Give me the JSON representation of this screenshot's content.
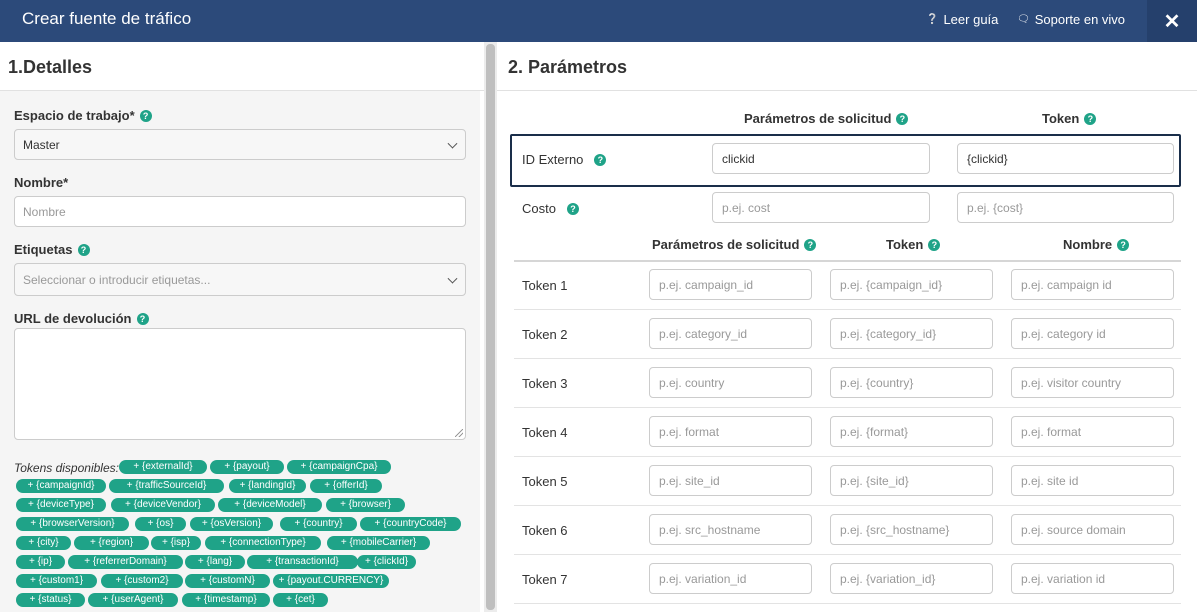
{
  "header": {
    "title": "Crear fuente de tráfico",
    "guide_label": "Leer guía",
    "support_label": "Soporte en vivo",
    "close_label": "✕"
  },
  "details": {
    "title": "1.Detalles",
    "workspace": {
      "label": "Espacio de trabajo*",
      "value": "Master"
    },
    "name": {
      "label": "Nombre*",
      "placeholder": "Nombre"
    },
    "tags": {
      "label": "Etiquetas",
      "placeholder": "Seleccionar o introducir etiquetas..."
    },
    "postback": {
      "label": "URL de devolución",
      "value": ""
    },
    "tokens_label": "Tokens disponibles:",
    "tokens": [
      "+ {externalId}",
      "+ {payout}",
      "+ {campaignCpa}",
      "+ {campaignId}",
      "+ {trafficSourceId}",
      "+ {landingId}",
      "+ {offerId}",
      "+ {deviceType}",
      "+ {deviceVendor}",
      "+ {deviceModel}",
      "+ {browser}",
      "+ {browserVersion}",
      "+ {os}",
      "+ {osVersion}",
      "+ {country}",
      "+ {countryCode}",
      "+ {city}",
      "+ {region}",
      "+ {isp}",
      "+ {connectionType}",
      "+ {mobileCarrier}",
      "+ {ip}",
      "+ {referrerDomain}",
      "+ {lang}",
      "+ {transactionId}",
      "+ {clickId}",
      "+ {custom1}",
      "+ {custom2}",
      "+ {customN}",
      "+ {payout.CURRENCY}",
      "+ {status}",
      "+ {userAgent}",
      "+ {timestamp}",
      "+ {cet}"
    ]
  },
  "params": {
    "title": "2. Parámetros",
    "top_headers": {
      "request_param": "Parámetros de solicitud",
      "token": "Token"
    },
    "external_id": {
      "label": "ID Externo",
      "param": "clickid",
      "token": "{clickid}"
    },
    "cost": {
      "label": "Costo",
      "param_placeholder": "p.ej. cost",
      "token_placeholder": "p.ej. {cost}"
    },
    "table_headers": {
      "request_param": "Parámetros de solicitud",
      "token": "Token",
      "name": "Nombre"
    },
    "rows": [
      {
        "label": "Token 1",
        "param": "p.ej. campaign_id",
        "token": "p.ej. {campaign_id}",
        "name": "p.ej. campaign id"
      },
      {
        "label": "Token 2",
        "param": "p.ej. category_id",
        "token": "p.ej. {category_id}",
        "name": "p.ej. category id"
      },
      {
        "label": "Token 3",
        "param": "p.ej. country",
        "token": "p.ej. {country}",
        "name": "p.ej. visitor country"
      },
      {
        "label": "Token 4",
        "param": "p.ej. format",
        "token": "p.ej. {format}",
        "name": "p.ej. format"
      },
      {
        "label": "Token 5",
        "param": "p.ej. site_id",
        "token": "p.ej. {site_id}",
        "name": "p.ej. site id"
      },
      {
        "label": "Token 6",
        "param": "p.ej. src_hostname",
        "token": "p.ej.  {src_hostname}",
        "name": "p.ej. source domain"
      },
      {
        "label": "Token 7",
        "param": "p.ej. variation_id",
        "token": "p.ej. {variation_id}",
        "name": "p.ej. variation id"
      }
    ]
  },
  "colors": {
    "header_bg": "#2c4a7a",
    "accent": "#1fa388",
    "highlight_border": "#1a2e4a"
  },
  "icons": {
    "guide": "question-circle-icon",
    "support": "chat-bubbles-icon",
    "close": "close-icon",
    "help": "question-circle-icon"
  }
}
